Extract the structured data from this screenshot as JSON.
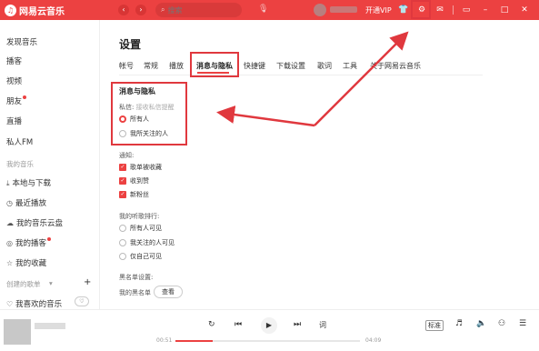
{
  "colors": {
    "brand": "#ec4141",
    "arrow": "#e0383e"
  },
  "app": {
    "title": "网易云音乐"
  },
  "search": {
    "placeholder": "搜索"
  },
  "topbar": {
    "vip_label": "开通VIP"
  },
  "sidebar": {
    "items": [
      {
        "label": "发现音乐"
      },
      {
        "label": "播客"
      },
      {
        "label": "视频"
      },
      {
        "label": "朋友"
      },
      {
        "label": "直播"
      },
      {
        "label": "私人FM"
      }
    ],
    "my_music_heading": "我的音乐",
    "my_music": [
      {
        "label": "本地与下载"
      },
      {
        "label": "最近播放"
      },
      {
        "label": "我的音乐云盘"
      },
      {
        "label": "我的播客"
      },
      {
        "label": "我的收藏"
      }
    ],
    "created_heading": "创建的歌单",
    "liked": "我喜欢的音乐"
  },
  "main": {
    "title": "设置",
    "tabs": [
      "帐号",
      "常规",
      "播放",
      "消息与隐私",
      "快捷键",
      "下载设置",
      "歌词",
      "工具",
      "关于网易云音乐"
    ],
    "active_tab": "消息与隐私",
    "privacy": {
      "heading": "消息与隐私",
      "dm_label": "私信:",
      "dm_hint": "接收私信提醒",
      "options": [
        {
          "label": "所有人",
          "selected": true
        },
        {
          "label": "我所关注的人",
          "selected": false
        }
      ]
    },
    "notify": {
      "label": "通知:",
      "items": [
        "歌单被收藏",
        "收到赞",
        "新粉丝"
      ]
    },
    "ranking": {
      "label": "我的听歌排行:",
      "options": [
        {
          "label": "所有人可见",
          "selected": false
        },
        {
          "label": "我关注的人可见",
          "selected": false
        },
        {
          "label": "仅自己可见",
          "selected": false
        }
      ]
    },
    "blacklist": {
      "label": "黑名单设置:",
      "my_label": "我的黑名单",
      "view_button": "查看"
    }
  },
  "player": {
    "time_elapsed": "00:51",
    "time_total": "04:09",
    "progress": 0.2,
    "lyrics_label": "词",
    "quality_label": "标准"
  }
}
